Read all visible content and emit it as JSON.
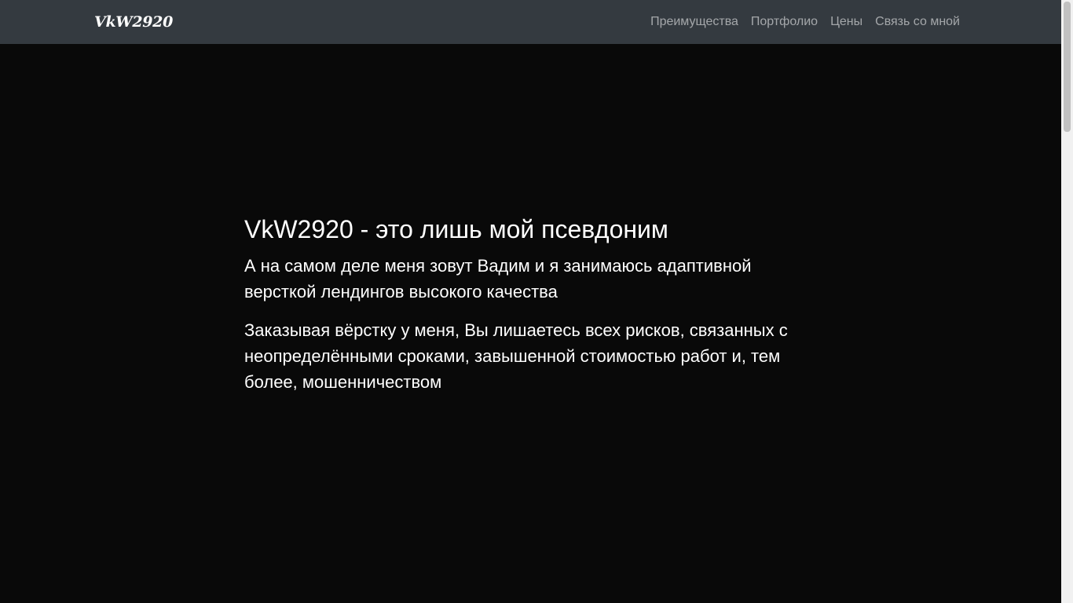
{
  "navbar": {
    "brand": "VkW2920",
    "links": [
      "Преимущества",
      "Портфолио",
      "Цены",
      "Связь со мной"
    ]
  },
  "hero": {
    "title": "VkW2920 - это лишь мой псевдоним",
    "lead": "А на самом деле меня зовут Вадим и я занимаюсь адаптивной версткой лендингов высокого качества",
    "text": "Заказывая вёрстку у меня, Вы лишаетесь всех рисков, связанных с неопределёнными сроками, завышенной стоимостью работ и, тем более, мошенничеством"
  },
  "colors": {
    "navbar_bg": "#343a40",
    "page_bg": "#090909",
    "nav_link": "rgba(255,255,255,0.55)"
  }
}
